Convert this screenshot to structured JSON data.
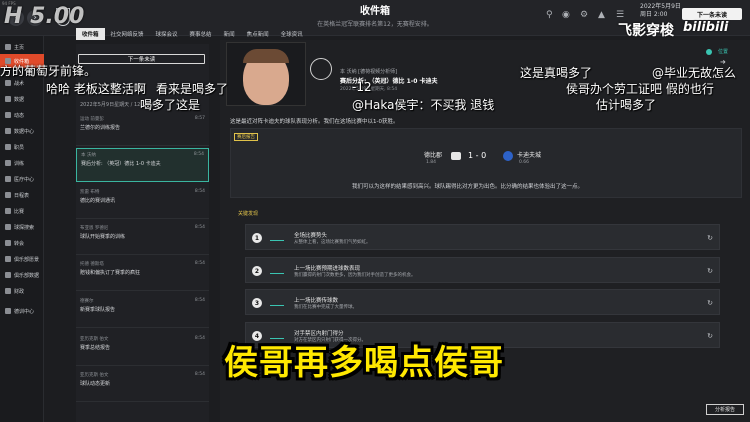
{
  "window_label": "94 FPS",
  "top": {
    "title": "收件箱",
    "subtitle": "在英格兰冠军联赛排名第12，无赛程安排。",
    "date_line1": "2022年5月9日",
    "date_line2": "周日 2:00",
    "next_btn": "下一条未读"
  },
  "leftnav": [
    "主页",
    "收件箱",
    "战术",
    "数据",
    "动态",
    "数据中心",
    "职员",
    "训练",
    "医疗中心",
    "日程表",
    "比赛",
    "球探搜索",
    "转会",
    "俱乐部愿景",
    "俱乐部数据",
    "财政",
    "德训中心"
  ],
  "tabs": [
    "收件箱",
    "社交网络反馈",
    "球探会议",
    "赛事总结",
    "新闻",
    "焦点新闻",
    "全球资讯"
  ],
  "inbox": {
    "next_btn": "下一条未读",
    "date_header": "2022年5月9日星期天 / 12条未读",
    "mails": [
      {
        "sender": "运动 前曼彭",
        "title": "兰德尔的训练报告",
        "time": "8:57"
      },
      {
        "sender": "本 沃纳",
        "title": "赛后分析: （英冠）德比 1-0 卡迪夫",
        "time": "8:54"
      },
      {
        "sender": "凯雷 布特",
        "title": "德比的赛训通讯",
        "time": "8:54"
      },
      {
        "sender": "布亚恩 罗德尼",
        "title": "球队开始赛季的训练",
        "time": "8:54"
      },
      {
        "sender": "托德 德斯塔",
        "title": "赔钱和偏执订了赛季的疯狂",
        "time": "8:54"
      },
      {
        "sender": "德赛尔",
        "title": "新赛季球队报告",
        "time": "8:54"
      },
      {
        "sender": "亚历克斯 伯文",
        "title": "赛季总结报告",
        "time": "8:54"
      },
      {
        "sender": "亚历克斯 伯文",
        "title": "球队动态更新",
        "time": "8:54"
      }
    ]
  },
  "report": {
    "from": "本 沃纳 [德荷视频分析师]",
    "subject": "赛后分析: （英冠）德比 1-0 卡迪夫",
    "date_line": "2022年5月9日星期天, 8:54",
    "intro": "这是最近对阵卡迪夫的球队表现分析。我们在这场比赛中以1-0获胜。",
    "label": "赛后报告",
    "home": "德比郡",
    "home_xg": "1.84",
    "score": "1 - 0",
    "away": "卡迪夫城",
    "away_xg": "0.66",
    "summary": "我们可以为这样的结果感到高兴。球队踢得比对方更为出色。比分确的结果也体验出了这一点。",
    "key_label": "关键发现",
    "steps": [
      {
        "n": "1",
        "t": "全场比赛势头",
        "d": "从整体上看，这场比赛我们气势如虹。"
      },
      {
        "n": "2",
        "t": "上一场比赛预期进球数表现",
        "d": "我们赢得的射门次数更多，因为我们对手创造了更多的机会。"
      },
      {
        "n": "3",
        "t": "上一场比赛传球数",
        "d": "我们在比赛中完成了大量传球。"
      },
      {
        "n": "4",
        "t": "对手禁区内射门得分",
        "d": "对方在禁区内只射门获得一次得分。"
      }
    ],
    "analysis_btn": "分析报告"
  },
  "danmaku": [
    "方的葡萄牙前锋。",
    "哈哈 老板这整活啊",
    "看来是喝多了",
    "喝多了这是",
    "这是真喝多了",
    "@毕业无故怎么",
    "-12",
    "@Haka侯宇：不买我 退钱",
    "估计喝多了",
    "侯哥办个劳工证吧 假的也行"
  ],
  "subtitle": "侯哥再多喝点侯哥",
  "watermark": {
    "left": "H 5.00",
    "right": "飞影穿梭",
    "bili": "bilibili"
  },
  "side_tag": "位置"
}
